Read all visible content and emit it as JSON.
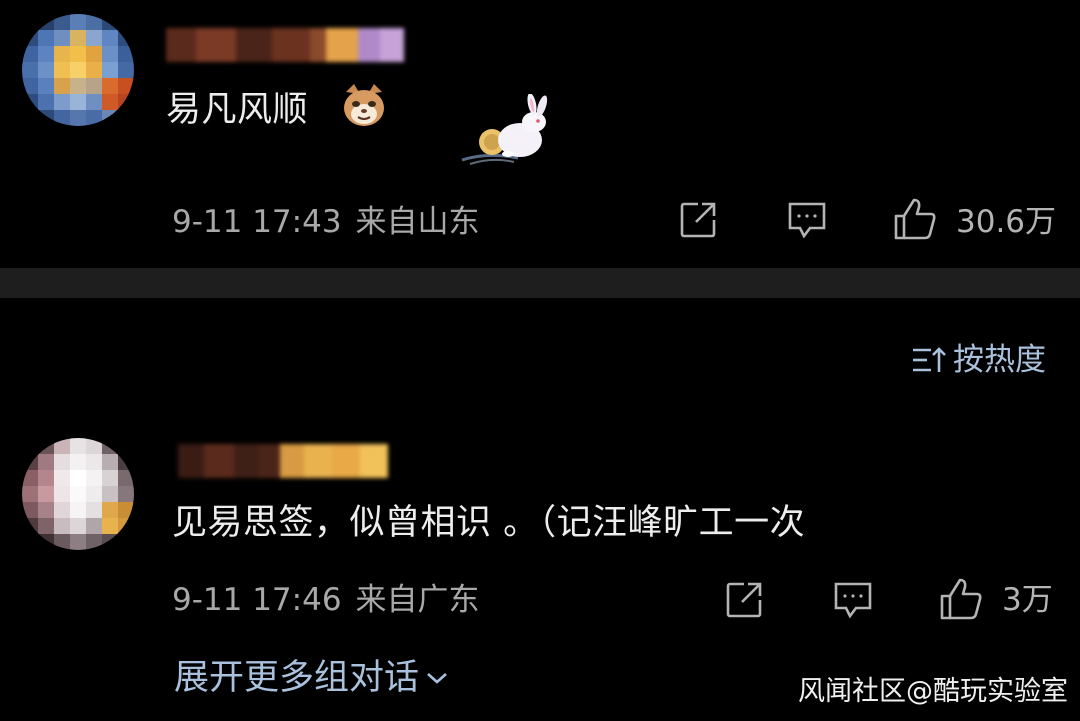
{
  "comments": [
    {
      "text": "易凡风顺",
      "emoji": "cat-face-emoji",
      "sticker": "moon-rabbit-sticker",
      "time": "9-11 17:43",
      "location": "来自山东",
      "likes": "30.6万"
    },
    {
      "text": "见易思签，似曾相识 。（记汪峰旷工一次",
      "time": "9-11 17:46",
      "location": "来自广东",
      "likes": "3万"
    }
  ],
  "sort": {
    "label": "按热度",
    "icon": "sort-icon"
  },
  "expand": {
    "label": "展开更多组对话",
    "icon": "chevron-down-icon"
  },
  "actions": {
    "share_icon": "share-icon",
    "reply_icon": "comment-icon",
    "like_icon": "thumbs-up-icon"
  },
  "watermark": "风闻社区@酷玩实验室",
  "colors": {
    "background": "#000000",
    "divider": "#1e1e1e",
    "meta_text": "#a8a8a8",
    "link_blue": "#a9c1dd"
  }
}
